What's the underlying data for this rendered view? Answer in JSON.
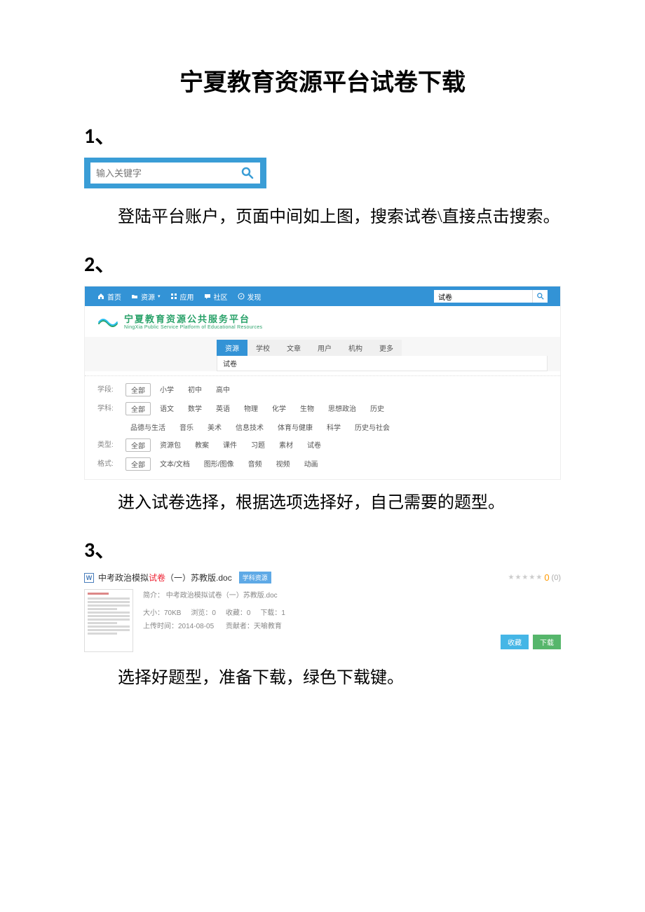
{
  "title": "宁夏教育资源平台试卷下载",
  "steps": {
    "s1": {
      "heading": "1、",
      "text": "登陆平台账户，页面中间如上图，搜索试卷\\直接点击搜索。"
    },
    "s2": {
      "heading": "2、",
      "text": "进入试卷选择，根据选项选择好，自己需要的题型。"
    },
    "s3": {
      "heading": "3、",
      "text": "选择好题型，准备下载，绿色下载键。"
    }
  },
  "fig1": {
    "search_placeholder": "输入关键字"
  },
  "fig2": {
    "nav": {
      "home": "首页",
      "resource": "资源",
      "app": "应用",
      "community": "社区",
      "discover": "发现"
    },
    "top_search_value": "试卷",
    "logo": {
      "cn": "宁夏教育资源公共服务平台",
      "en": "NingXia Public Service Platform of Educational Resources"
    },
    "tabs": {
      "active": "资源",
      "others": [
        "学校",
        "文章",
        "用户",
        "机构",
        "更多"
      ]
    },
    "sub_keyword": "试卷",
    "filters": {
      "stage": {
        "label": "学段:",
        "selected": "全部",
        "options": [
          "小学",
          "初中",
          "高中"
        ]
      },
      "subject": {
        "label": "学科:",
        "selected": "全部",
        "row1": [
          "语文",
          "数学",
          "英语",
          "物理",
          "化学",
          "生物",
          "思想政治",
          "历史"
        ],
        "row2": [
          "品德与生活",
          "音乐",
          "美术",
          "信息技术",
          "体育与健康",
          "科学",
          "历史与社会"
        ]
      },
      "type": {
        "label": "类型:",
        "selected": "全部",
        "options": [
          "资源包",
          "教案",
          "课件",
          "习题",
          "素材",
          "试卷"
        ]
      },
      "format": {
        "label": "格式:",
        "selected": "全部",
        "options": [
          "文本/文档",
          "图形/图像",
          "音频",
          "视频",
          "动画"
        ]
      }
    }
  },
  "fig3": {
    "word_mark": "W",
    "title_pre": "中考政治模拟",
    "title_hl": "试卷",
    "title_post": "（一）苏教版.doc",
    "badge": "学科资源",
    "rating_value": "0",
    "rating_count": "(0)",
    "intro_label": "简介：",
    "intro_value": "中考政治模拟试卷（一）苏教版.doc",
    "meta": {
      "size_label": "大小：",
      "size": "70KB",
      "view_label": "浏览：",
      "view": "0",
      "fav_label": "收藏：",
      "fav": "0",
      "dl_label": "下载：",
      "dl": "1",
      "time_label": "上传时间：",
      "time": "2014-08-05",
      "contrib_label": "贡献者：",
      "contrib": "天喻教育"
    },
    "actions": {
      "favorite": "收藏",
      "download": "下载"
    }
  }
}
